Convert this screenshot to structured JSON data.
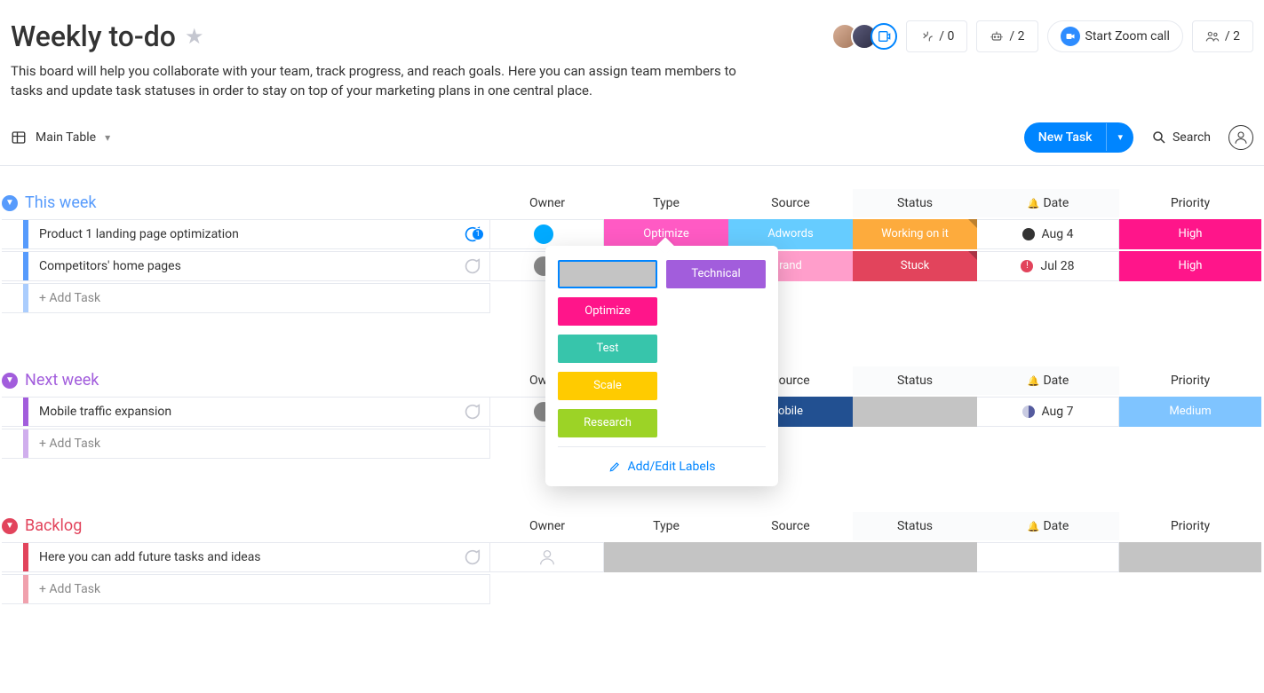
{
  "board": {
    "title": "Weekly to-do",
    "description": "This board will help you collaborate with your team, track progress, and reach goals. Here you can assign team members to tasks and update task statuses in order to stay on top of your marketing plans in one central place."
  },
  "header_buttons": {
    "integrations_label": "/ 0",
    "automations_label": "/ 2",
    "zoom_label": "Start Zoom call",
    "members_label": "/ 2"
  },
  "toolbar": {
    "view_name": "Main Table",
    "new_task_label": "New Task",
    "search_label": "Search"
  },
  "columns": {
    "owner": "Owner",
    "type": "Type",
    "source": "Source",
    "status": "Status",
    "date": "Date",
    "priority": "Priority"
  },
  "groups": [
    {
      "id": "this_week",
      "title": "This week",
      "color": "#579bfc",
      "tasks": [
        {
          "name": "Product 1 landing page optimization",
          "chat_active": true,
          "chat_count": "1",
          "owner_color": "#00aaff",
          "type": {
            "label": "Optimize",
            "color": "#ff5ac4"
          },
          "source": {
            "label": "Adwords",
            "color": "#66ccff"
          },
          "status": {
            "label": "Working on it",
            "color": "#fdab3d"
          },
          "date": {
            "label": "Aug 4",
            "dot_color": "#333333"
          },
          "priority": {
            "label": "High",
            "color": "#ff158a"
          }
        },
        {
          "name": "Competitors' home pages",
          "chat_active": false,
          "chat_count": "",
          "owner_color": "#888888",
          "type": {
            "label": "",
            "color": "#c4c4c4"
          },
          "source": {
            "label": "rand",
            "color": "#ff9ecb"
          },
          "status": {
            "label": "Stuck",
            "color": "#e2445c"
          },
          "date": {
            "label": "Jul 28",
            "dot_color": "#e2445c"
          },
          "priority": {
            "label": "High",
            "color": "#ff158a"
          }
        }
      ],
      "add_task_label": "+ Add Task"
    },
    {
      "id": "next_week",
      "title": "Next week",
      "color": "#a25ddc",
      "tasks": [
        {
          "name": "Mobile traffic expansion",
          "chat_active": false,
          "chat_count": "",
          "owner_color": "#888888",
          "type": {
            "label": "",
            "color": "#c4c4c4"
          },
          "source": {
            "label": "obile",
            "color": "#225091"
          },
          "status": {
            "label": "",
            "color": "#c4c4c4"
          },
          "date": {
            "label": "Aug 7",
            "dot_color": "#555b9e"
          },
          "priority": {
            "label": "Medium",
            "color": "#7fc4ff"
          }
        }
      ],
      "add_task_label": "+ Add Task"
    },
    {
      "id": "backlog",
      "title": "Backlog",
      "color": "#e2445c",
      "tasks": [
        {
          "name": "Here you can add future tasks and ideas",
          "chat_active": false,
          "chat_count": "",
          "owner_color": null,
          "type": {
            "label": "",
            "color": "#c4c4c4"
          },
          "source": {
            "label": "",
            "color": "#c4c4c4"
          },
          "status": {
            "label": "",
            "color": "#c4c4c4"
          },
          "date": {
            "label": "",
            "dot_color": ""
          },
          "priority": {
            "label": "",
            "color": "#c4c4c4"
          }
        }
      ],
      "add_task_label": "+ Add Task"
    }
  ],
  "label_picker": {
    "options_left": [
      {
        "label": "",
        "color": "blank"
      },
      {
        "label": "Optimize",
        "color": "#ff158a"
      },
      {
        "label": "Test",
        "color": "#37c5ab"
      },
      {
        "label": "Scale",
        "color": "#ffcb00"
      },
      {
        "label": "Research",
        "color": "#9cd326"
      }
    ],
    "options_right": [
      {
        "label": "Technical",
        "color": "#a25ddc"
      }
    ],
    "footer_label": "Add/Edit Labels"
  }
}
